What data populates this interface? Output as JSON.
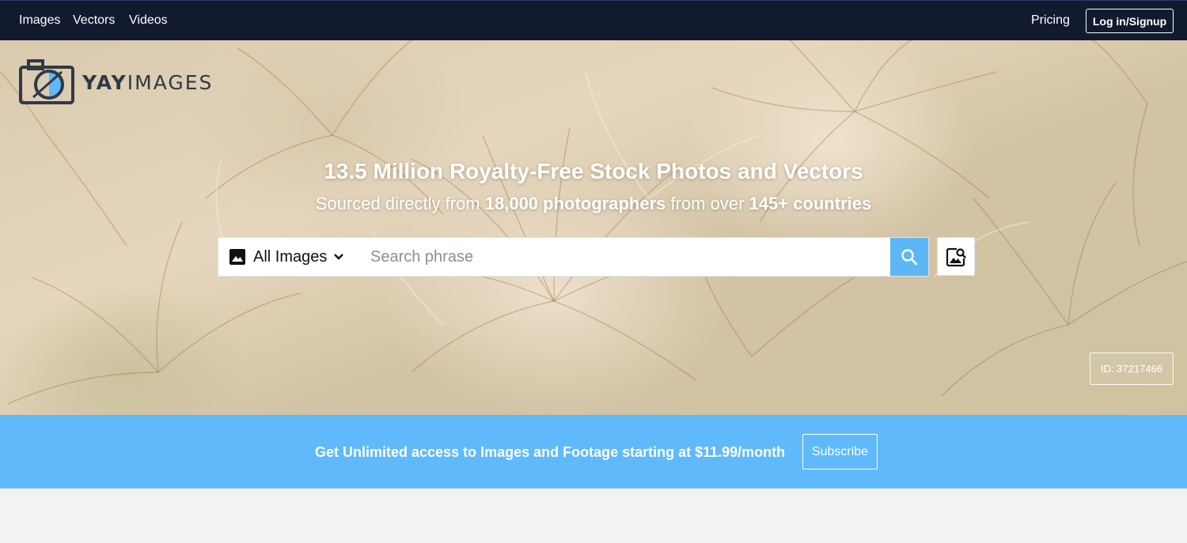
{
  "nav": {
    "links": [
      "Images",
      "Vectors",
      "Videos"
    ],
    "pricing": "Pricing",
    "login": "Log in/Signup"
  },
  "logo": {
    "yay": "YAY",
    "images": "IMAGES"
  },
  "hero": {
    "headline": "13.5 Million Royalty-Free Stock Photos and Vectors",
    "sub_prefix": "Sourced directly from ",
    "sub_photographers": "18,000 photographers",
    "sub_middle": " from over ",
    "sub_countries": "145+ countries",
    "image_id": "ID: 37217466"
  },
  "search": {
    "type_label": "All Images",
    "placeholder": "Search phrase",
    "value": ""
  },
  "promo": {
    "text": "Get Unlimited access to Images and Footage starting at $11.99/month",
    "subscribe": "Subscribe"
  },
  "icons": {
    "logo": "camera-logo-icon",
    "type": "image-icon",
    "dropdown": "chevron-down-icon",
    "search": "search-icon",
    "image_search": "image-search-icon"
  },
  "colors": {
    "nav_bg": "#111a2e",
    "accent": "#5fb9fa",
    "search_button": "#5db7f5"
  }
}
